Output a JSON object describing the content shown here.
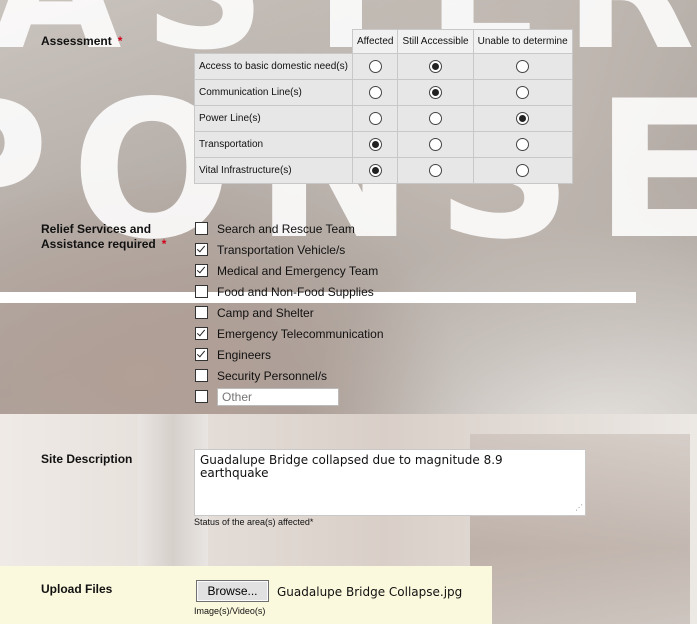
{
  "background_text": {
    "top": "ASTER",
    "middle": "PONSE"
  },
  "assessment": {
    "label": "Assessment",
    "required_mark": "*",
    "columns": [
      "Affected",
      "Still Accessible",
      "Unable to determine"
    ],
    "rows": [
      {
        "label": "Access to basic domestic need(s)",
        "selected": 1
      },
      {
        "label": "Communication Line(s)",
        "selected": 1
      },
      {
        "label": "Power Line(s)",
        "selected": 2
      },
      {
        "label": "Transportation",
        "selected": 0
      },
      {
        "label": "Vital Infrastructure(s)",
        "selected": 0
      }
    ]
  },
  "relief": {
    "label_line1": "Relief Services and",
    "label_line2": "Assistance required",
    "required_mark": "*",
    "options": [
      {
        "label": "Search and Rescue Team",
        "checked": false
      },
      {
        "label": "Transportation Vehicle/s",
        "checked": true
      },
      {
        "label": "Medical and Emergency Team",
        "checked": true
      },
      {
        "label": "Food and Non-Food Supplies",
        "checked": false
      },
      {
        "label": "Camp and Shelter",
        "checked": false
      },
      {
        "label": "Emergency Telecommunication",
        "checked": true
      },
      {
        "label": "Engineers",
        "checked": true
      },
      {
        "label": "Security Personnel/s",
        "checked": false
      }
    ],
    "other": {
      "checked": false,
      "placeholder": "Other"
    }
  },
  "site": {
    "label": "Site Description",
    "value": "Guadalupe Bridge collapsed due to magnitude 8.9\nearthquake",
    "hint": "Status of the area(s) affected*"
  },
  "upload": {
    "label": "Upload Files",
    "button": "Browse...",
    "filename": "Guadalupe Bridge Collapse.jpg",
    "hint": "Image(s)/Video(s)"
  },
  "colors": {
    "required": "#d0021b",
    "upload_band": "#fbf9dd"
  }
}
